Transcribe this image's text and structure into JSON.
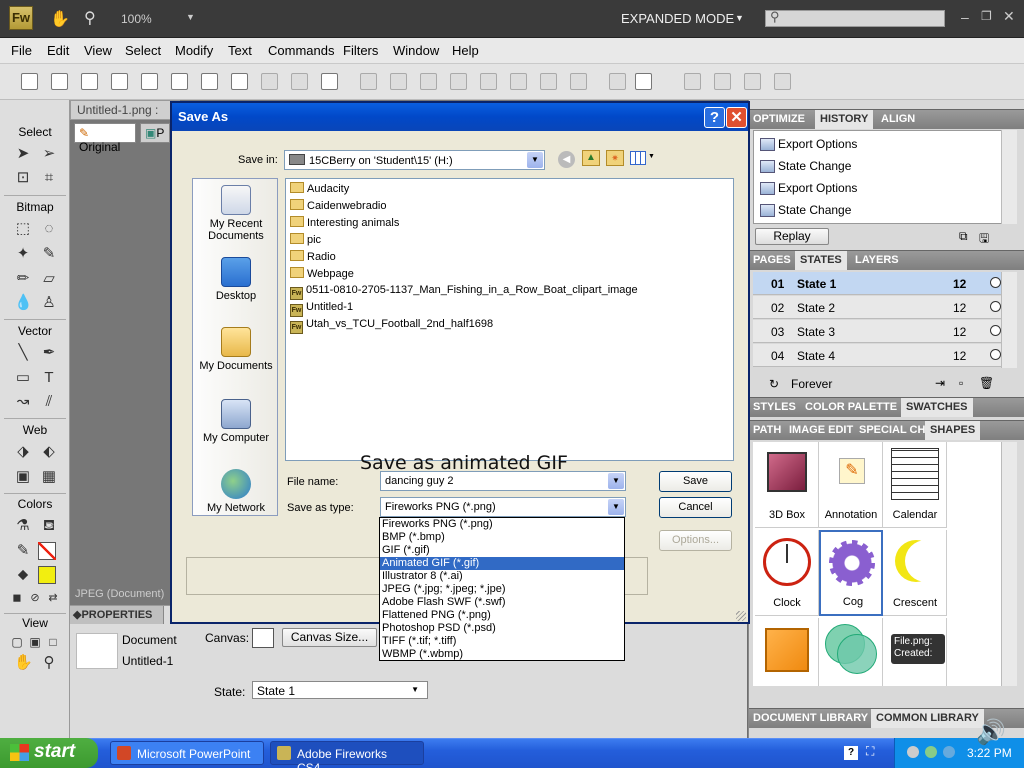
{
  "app": {
    "logo": "Fw",
    "zoom": "100%",
    "mode": "EXPANDED MODE",
    "menu": [
      "File",
      "Edit",
      "View",
      "Select",
      "Modify",
      "Text",
      "Commands",
      "Filters",
      "Window",
      "Help"
    ]
  },
  "document": {
    "tab_title": "Untitled-1.png :",
    "view_original": "Original",
    "view_preview": "P",
    "status": "JPEG (Document)"
  },
  "tools": {
    "sections": [
      "Select",
      "Bitmap",
      "Vector",
      "Web",
      "Colors",
      "View"
    ]
  },
  "properties": {
    "tab": "PROPERTIES",
    "doc_label": "Document",
    "doc_name": "Untitled-1",
    "canvas_label": "Canvas:",
    "canvas_size_button": "Canvas Size...",
    "state_label": "State:",
    "state_value": "State 1"
  },
  "right_panels": {
    "top_tabs": [
      "OPTIMIZE",
      "HISTORY",
      "ALIGN"
    ],
    "history": [
      "Export Options",
      "State Change",
      "Export Options",
      "State Change"
    ],
    "replay": "Replay",
    "states_tabs": [
      "PAGES",
      "STATES",
      "LAYERS"
    ],
    "states": [
      {
        "num": "01",
        "name": "State 1",
        "delay": "12"
      },
      {
        "num": "02",
        "name": "State 2",
        "delay": "12"
      },
      {
        "num": "03",
        "name": "State 3",
        "delay": "12"
      },
      {
        "num": "04",
        "name": "State 4",
        "delay": "12"
      }
    ],
    "loop": "Forever",
    "styles_tabs": [
      "STYLES",
      "COLOR PALETTE",
      "SWATCHES"
    ],
    "shapes_tabs": [
      "PATH",
      "IMAGE EDIT",
      "SPECIAL CH",
      "SHAPES"
    ],
    "shapes": [
      "3D Box",
      "Annotation",
      "Calendar",
      "Clock",
      "Cog",
      "Crescent"
    ],
    "tooltip": "File.png: Created:",
    "library_tabs": [
      "DOCUMENT LIBRARY",
      "COMMON LIBRARY"
    ]
  },
  "dialog": {
    "title": "Save As",
    "save_in_label": "Save in:",
    "save_in_value": "15CBerry on 'Student\\15' (H:)",
    "places": [
      "My Recent Documents",
      "Desktop",
      "My Documents",
      "My Computer",
      "My Network"
    ],
    "folders": [
      "Audacity",
      "Caidenwebradio",
      "Interesting animals",
      "pic",
      "Radio",
      "Webpage"
    ],
    "files": [
      "0511-0810-2705-1137_Man_Fishing_in_a_Row_Boat_clipart_image",
      "Untitled-1",
      "Utah_vs_TCU_Football_2nd_half1698"
    ],
    "file_name_label": "File name:",
    "file_name_value": "dancing guy 2",
    "save_type_label": "Save as type:",
    "save_type_value": "Fireworks PNG (*.png)",
    "save_button": "Save",
    "cancel_button": "Cancel",
    "options_button": "Options...",
    "type_options": [
      "Fireworks PNG (*.png)",
      "BMP (*.bmp)",
      "GIF (*.gif)",
      "Animated GIF (*.gif)",
      "Illustrator 8 (*.ai)",
      "JPEG (*.jpg; *.jpeg; *.jpe)",
      "Adobe Flash SWF (*.swf)",
      "Flattened PNG (*.png)",
      "Photoshop PSD (*.psd)",
      "TIFF (*.tif; *.tiff)",
      "WBMP (*.wbmp)"
    ],
    "selected_option_index": 3
  },
  "overlay_caption": "Save as animated GIF",
  "taskbar": {
    "start": "start",
    "items": [
      "Microsoft PowerPoint ...",
      "Adobe Fireworks CS4..."
    ],
    "clock": "3:22 PM"
  }
}
